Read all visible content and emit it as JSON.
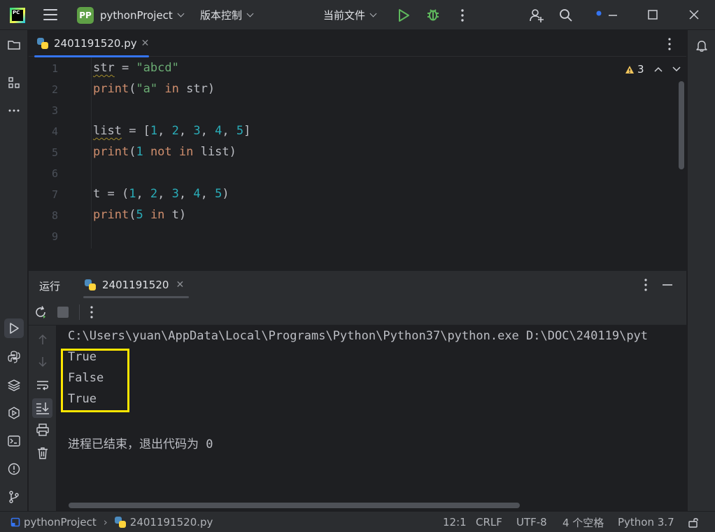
{
  "titlebar": {
    "logo_text": "PC",
    "project_badge": "PP",
    "project_name": "pythonProject",
    "vcs_label": "版本控制",
    "run_config": "当前文件"
  },
  "editor": {
    "tab_label": "2401191520.py",
    "warning_count": "3",
    "line_numbers": [
      "1",
      "2",
      "3",
      "4",
      "5",
      "6",
      "7",
      "8",
      "9"
    ]
  },
  "run_panel": {
    "tab_run": "运行",
    "tab_config": "2401191520",
    "console": {
      "command": "C:\\Users\\yuan\\AppData\\Local\\Programs\\Python\\Python37\\python.exe D:\\DOC\\240119\\pyt",
      "outputs": [
        "True",
        "False",
        "True"
      ],
      "exit_message": "进程已结束，退出代码为 0"
    }
  },
  "statusbar": {
    "project": "pythonProject",
    "file": "2401191520.py",
    "position": "12:1",
    "line_ending": "CRLF",
    "encoding": "UTF-8",
    "indent": "4 个空格",
    "interpreter": "Python 3.7"
  },
  "colors": {
    "highlight_box": "#ffe600",
    "accent": "#3574f0",
    "run_green": "#5fb85d"
  }
}
